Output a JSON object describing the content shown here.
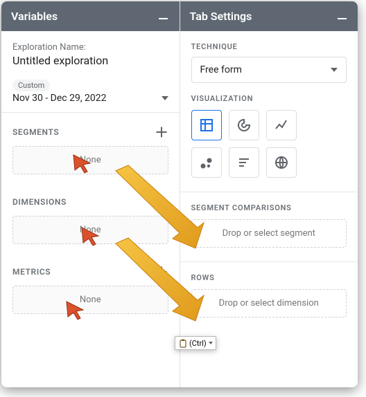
{
  "variables": {
    "panel_title": "Variables",
    "name_label": "Exploration Name:",
    "name_value": "Untitled exploration",
    "date_chip": "Custom",
    "date_range": "Nov 30 - Dec 29, 2022",
    "segments": {
      "label": "SEGMENTS",
      "placeholder": "None"
    },
    "dimensions": {
      "label": "DIMENSIONS",
      "placeholder": "None"
    },
    "metrics": {
      "label": "METRICS",
      "placeholder": "None"
    }
  },
  "tab_settings": {
    "panel_title": "Tab Settings",
    "technique_label": "TECHNIQUE",
    "technique_value": "Free form",
    "visualization_label": "VISUALIZATION",
    "segment_comparisons_label": "SEGMENT COMPARISONS",
    "segment_comparisons_placeholder": "Drop or select segment",
    "rows_label": "ROWS",
    "rows_placeholder": "Drop or select dimension"
  },
  "popup": {
    "text": "(Ctrl)"
  }
}
